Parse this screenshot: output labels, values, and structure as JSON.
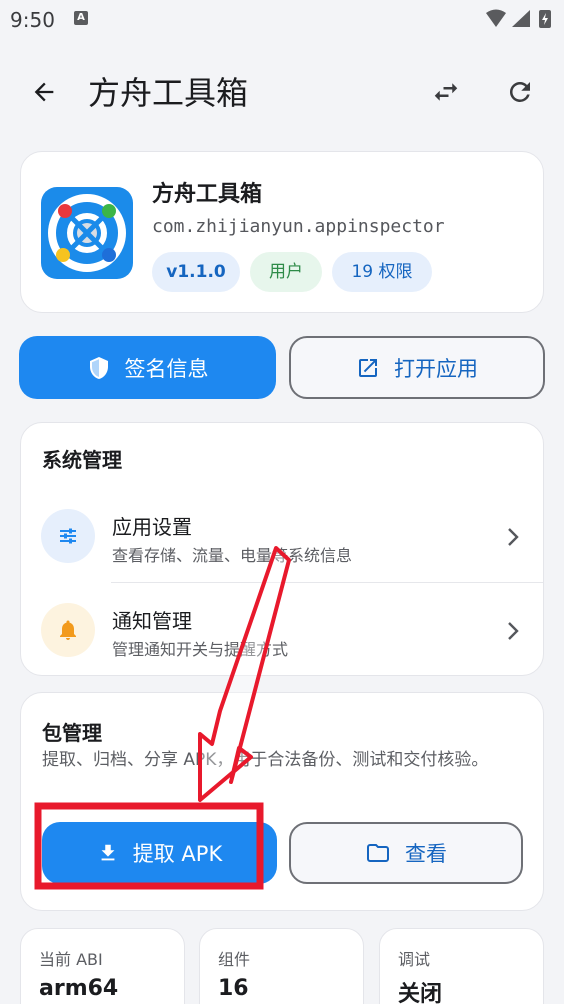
{
  "status_bar": {
    "time": "9:50",
    "notif_letter": "A"
  },
  "header": {
    "title": "方舟工具箱",
    "icons": [
      "back-arrow-icon",
      "swap-icon",
      "refresh-icon"
    ]
  },
  "app": {
    "name": "方舟工具箱",
    "package": "com.zhijianyun.appinspector",
    "chips": {
      "version": "v1.1.0",
      "type": "用户",
      "permissions": "19 权限"
    }
  },
  "actions": {
    "signature": "签名信息",
    "open_app": "打开应用"
  },
  "system": {
    "title": "系统管理",
    "items": [
      {
        "title": "应用设置",
        "subtitle": "查看存储、流量、电量等系统信息",
        "icon": "sliders-icon"
      },
      {
        "title": "通知管理",
        "subtitle": "管理通知开关与提醒方式",
        "icon": "bell-icon"
      }
    ]
  },
  "package_mgmt": {
    "title": "包管理",
    "description": "提取、归档、分享 APK，用于合法备份、测试和交付核验。",
    "extract_label": "提取 APK",
    "view_label": "查看"
  },
  "stats": [
    {
      "label": "当前 ABI",
      "value": "arm64"
    },
    {
      "label": "组件",
      "value": "16"
    },
    {
      "label": "调试",
      "value": "关闭"
    }
  ],
  "colors": {
    "primary": "#1E88F0",
    "annotation": "#E8192C",
    "background": "#F3F4F7"
  }
}
